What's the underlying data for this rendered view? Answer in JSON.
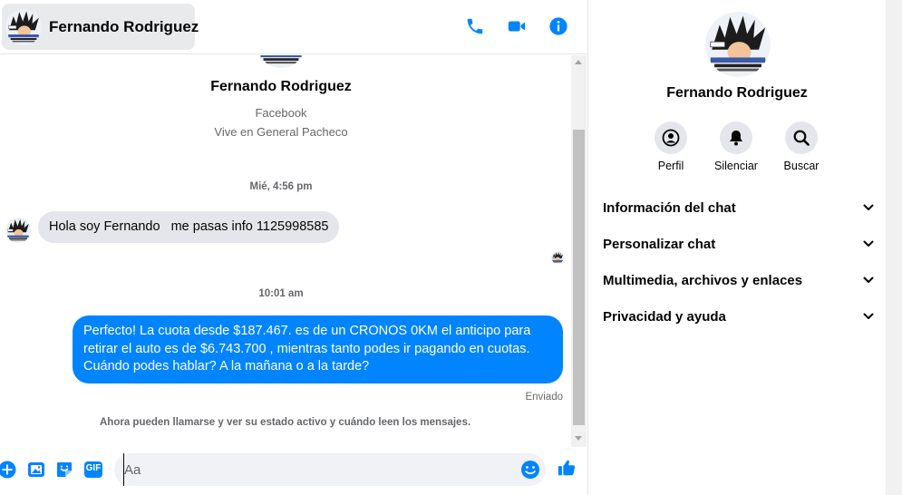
{
  "header": {
    "contact_name": "Fernando Rodriguez",
    "icons": [
      "phone-icon",
      "video-icon",
      "info-icon"
    ]
  },
  "intro": {
    "name": "Fernando Rodriguez",
    "network": "Facebook",
    "location": "Vive en General Pacheco"
  },
  "messages": {
    "timestamp_1": "Mié, 4:56 pm",
    "incoming_text": "Hola soy Fernando   me pasas info 1125998585",
    "timestamp_2": "10:01 am",
    "outgoing_text": "Perfecto! La cuota desde $187.467. es de un CRONOS 0KM el anticipo para retirar el auto es de $6.743.700 , mientras tanto podes ir pagando en cuotas. Cuándo podes hablar? A la mañana o a la tarde?",
    "status": "Enviado",
    "notice": "Ahora pueden llamarse y ver su estado activo y cuándo leen los mensajes."
  },
  "composer": {
    "placeholder": "Aa",
    "icons": [
      "plus-icon",
      "photo-icon",
      "sticker-icon",
      "gif-icon",
      "emoji-icon",
      "like-icon"
    ],
    "gif_label": "GIF"
  },
  "panel": {
    "name": "Fernando Rodriguez",
    "actions": [
      {
        "label": "Perfil",
        "icon": "profile-icon"
      },
      {
        "label": "Silenciar",
        "icon": "bell-icon"
      },
      {
        "label": "Buscar",
        "icon": "search-icon"
      }
    ],
    "sections": [
      {
        "label": "Información del chat"
      },
      {
        "label": "Personalizar chat"
      },
      {
        "label": "Multimedia, archivos y enlaces"
      },
      {
        "label": "Privacidad y ayuda"
      }
    ]
  },
  "colors": {
    "accent": "#0084ff",
    "incoming_bubble": "#e4e6eb",
    "muted_text": "#65676b"
  }
}
